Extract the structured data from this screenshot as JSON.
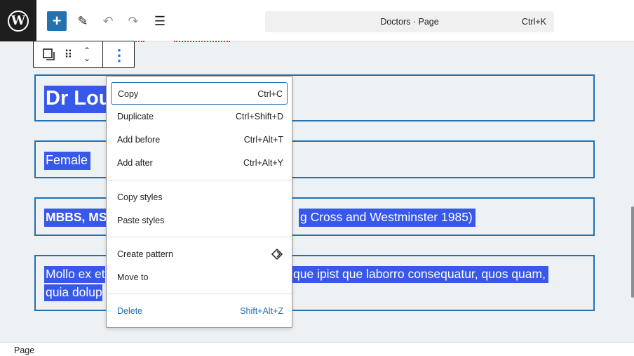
{
  "topbar": {
    "logo_icon": "wordpress-logo-icon",
    "logo_glyph": "W",
    "add_icon_glyph": "+",
    "edit_icon_glyph": "✎",
    "undo_icon_glyph": "↶",
    "redo_icon_glyph": "↷",
    "list_icon_glyph": "☰",
    "command_bar_title": "Doctors · Page",
    "command_bar_shortcut": "Ctrl+K"
  },
  "block_toolbar": {
    "drag_glyph": "⠿",
    "move_up_glyph": "⌃",
    "move_down_glyph": "⌄",
    "options_glyph": "⋮"
  },
  "blocks": [
    {
      "text": "Dr Lou"
    },
    {
      "text": "Female"
    },
    {
      "text_a": "MBBS, MSc",
      "text_b": "g Cross and Westminster 1985)"
    },
    {
      "line1_a": "Mollo ex et",
      "line1_b": "que ipist que laborro consequatur, quos quam,",
      "line2_a": "quia dolup"
    }
  ],
  "menu": {
    "groups": [
      [
        {
          "label": "Copy",
          "shortcut": "Ctrl+C",
          "focused": true
        },
        {
          "label": "Duplicate",
          "shortcut": "Ctrl+Shift+D"
        },
        {
          "label": "Add before",
          "shortcut": "Ctrl+Alt+T"
        },
        {
          "label": "Add after",
          "shortcut": "Ctrl+Alt+Y"
        }
      ],
      [
        {
          "label": "Copy styles",
          "shortcut": ""
        },
        {
          "label": "Paste styles",
          "shortcut": ""
        }
      ],
      [
        {
          "label": "Create pattern",
          "icon": "symbol-diamond-icon"
        },
        {
          "label": "Move to",
          "shortcut": ""
        }
      ],
      [
        {
          "label": "Delete",
          "shortcut": "Shift+Alt+Z",
          "danger": true
        }
      ]
    ]
  },
  "footer": {
    "breadcrumb": "Page"
  },
  "colors": {
    "accent": "#2271b1",
    "selection": "#3858e9",
    "canvas_bg": "#edf1f3",
    "topbar_logo_bg": "#1e1e1e"
  }
}
